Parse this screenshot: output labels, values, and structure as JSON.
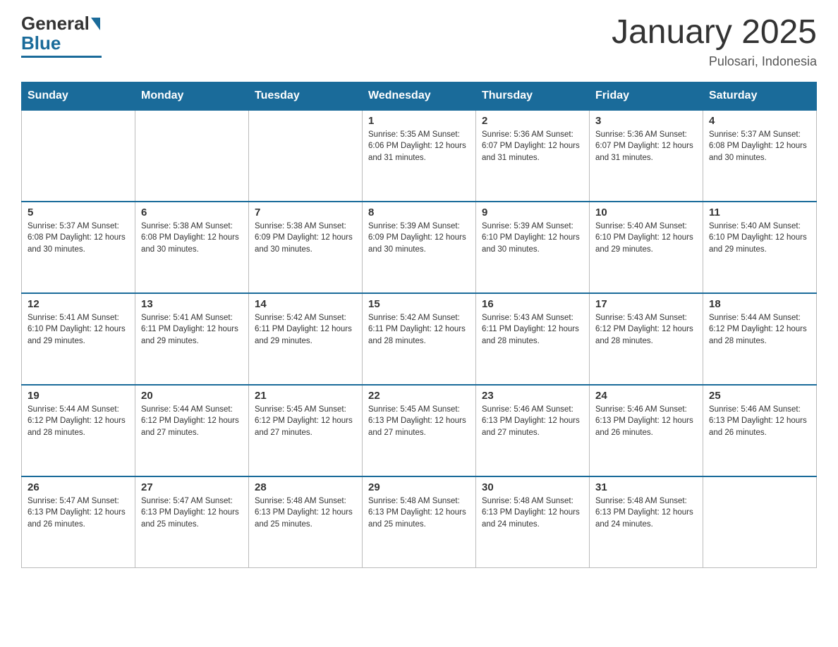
{
  "header": {
    "logo_general": "General",
    "logo_blue": "Blue",
    "month_title": "January 2025",
    "location": "Pulosari, Indonesia"
  },
  "days_of_week": [
    "Sunday",
    "Monday",
    "Tuesday",
    "Wednesday",
    "Thursday",
    "Friday",
    "Saturday"
  ],
  "weeks": [
    [
      {
        "day": "",
        "info": ""
      },
      {
        "day": "",
        "info": ""
      },
      {
        "day": "",
        "info": ""
      },
      {
        "day": "1",
        "info": "Sunrise: 5:35 AM\nSunset: 6:06 PM\nDaylight: 12 hours\nand 31 minutes."
      },
      {
        "day": "2",
        "info": "Sunrise: 5:36 AM\nSunset: 6:07 PM\nDaylight: 12 hours\nand 31 minutes."
      },
      {
        "day": "3",
        "info": "Sunrise: 5:36 AM\nSunset: 6:07 PM\nDaylight: 12 hours\nand 31 minutes."
      },
      {
        "day": "4",
        "info": "Sunrise: 5:37 AM\nSunset: 6:08 PM\nDaylight: 12 hours\nand 30 minutes."
      }
    ],
    [
      {
        "day": "5",
        "info": "Sunrise: 5:37 AM\nSunset: 6:08 PM\nDaylight: 12 hours\nand 30 minutes."
      },
      {
        "day": "6",
        "info": "Sunrise: 5:38 AM\nSunset: 6:08 PM\nDaylight: 12 hours\nand 30 minutes."
      },
      {
        "day": "7",
        "info": "Sunrise: 5:38 AM\nSunset: 6:09 PM\nDaylight: 12 hours\nand 30 minutes."
      },
      {
        "day": "8",
        "info": "Sunrise: 5:39 AM\nSunset: 6:09 PM\nDaylight: 12 hours\nand 30 minutes."
      },
      {
        "day": "9",
        "info": "Sunrise: 5:39 AM\nSunset: 6:10 PM\nDaylight: 12 hours\nand 30 minutes."
      },
      {
        "day": "10",
        "info": "Sunrise: 5:40 AM\nSunset: 6:10 PM\nDaylight: 12 hours\nand 29 minutes."
      },
      {
        "day": "11",
        "info": "Sunrise: 5:40 AM\nSunset: 6:10 PM\nDaylight: 12 hours\nand 29 minutes."
      }
    ],
    [
      {
        "day": "12",
        "info": "Sunrise: 5:41 AM\nSunset: 6:10 PM\nDaylight: 12 hours\nand 29 minutes."
      },
      {
        "day": "13",
        "info": "Sunrise: 5:41 AM\nSunset: 6:11 PM\nDaylight: 12 hours\nand 29 minutes."
      },
      {
        "day": "14",
        "info": "Sunrise: 5:42 AM\nSunset: 6:11 PM\nDaylight: 12 hours\nand 29 minutes."
      },
      {
        "day": "15",
        "info": "Sunrise: 5:42 AM\nSunset: 6:11 PM\nDaylight: 12 hours\nand 28 minutes."
      },
      {
        "day": "16",
        "info": "Sunrise: 5:43 AM\nSunset: 6:11 PM\nDaylight: 12 hours\nand 28 minutes."
      },
      {
        "day": "17",
        "info": "Sunrise: 5:43 AM\nSunset: 6:12 PM\nDaylight: 12 hours\nand 28 minutes."
      },
      {
        "day": "18",
        "info": "Sunrise: 5:44 AM\nSunset: 6:12 PM\nDaylight: 12 hours\nand 28 minutes."
      }
    ],
    [
      {
        "day": "19",
        "info": "Sunrise: 5:44 AM\nSunset: 6:12 PM\nDaylight: 12 hours\nand 28 minutes."
      },
      {
        "day": "20",
        "info": "Sunrise: 5:44 AM\nSunset: 6:12 PM\nDaylight: 12 hours\nand 27 minutes."
      },
      {
        "day": "21",
        "info": "Sunrise: 5:45 AM\nSunset: 6:12 PM\nDaylight: 12 hours\nand 27 minutes."
      },
      {
        "day": "22",
        "info": "Sunrise: 5:45 AM\nSunset: 6:13 PM\nDaylight: 12 hours\nand 27 minutes."
      },
      {
        "day": "23",
        "info": "Sunrise: 5:46 AM\nSunset: 6:13 PM\nDaylight: 12 hours\nand 27 minutes."
      },
      {
        "day": "24",
        "info": "Sunrise: 5:46 AM\nSunset: 6:13 PM\nDaylight: 12 hours\nand 26 minutes."
      },
      {
        "day": "25",
        "info": "Sunrise: 5:46 AM\nSunset: 6:13 PM\nDaylight: 12 hours\nand 26 minutes."
      }
    ],
    [
      {
        "day": "26",
        "info": "Sunrise: 5:47 AM\nSunset: 6:13 PM\nDaylight: 12 hours\nand 26 minutes."
      },
      {
        "day": "27",
        "info": "Sunrise: 5:47 AM\nSunset: 6:13 PM\nDaylight: 12 hours\nand 25 minutes."
      },
      {
        "day": "28",
        "info": "Sunrise: 5:48 AM\nSunset: 6:13 PM\nDaylight: 12 hours\nand 25 minutes."
      },
      {
        "day": "29",
        "info": "Sunrise: 5:48 AM\nSunset: 6:13 PM\nDaylight: 12 hours\nand 25 minutes."
      },
      {
        "day": "30",
        "info": "Sunrise: 5:48 AM\nSunset: 6:13 PM\nDaylight: 12 hours\nand 24 minutes."
      },
      {
        "day": "31",
        "info": "Sunrise: 5:48 AM\nSunset: 6:13 PM\nDaylight: 12 hours\nand 24 minutes."
      },
      {
        "day": "",
        "info": ""
      }
    ]
  ]
}
